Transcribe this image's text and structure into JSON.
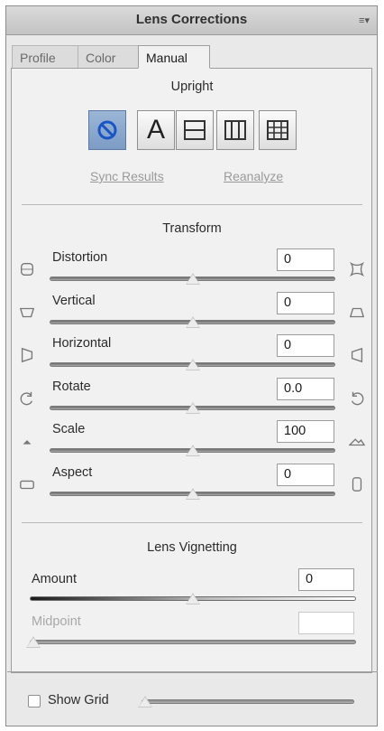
{
  "panel": {
    "title": "Lens Corrections",
    "menu_icon": "panel-menu-icon"
  },
  "tabs": [
    {
      "label": "Profile",
      "active": false
    },
    {
      "label": "Color",
      "active": false
    },
    {
      "label": "Manual",
      "active": true
    }
  ],
  "upright": {
    "title": "Upright",
    "buttons": [
      {
        "name": "off",
        "icon": "no-symbol-icon",
        "label": "",
        "selected": true
      },
      {
        "name": "auto",
        "icon": "",
        "label": "A",
        "selected": false
      },
      {
        "name": "level",
        "icon": "level-icon",
        "label": "",
        "selected": false
      },
      {
        "name": "vertical",
        "icon": "vertical-icon",
        "label": "",
        "selected": false
      },
      {
        "name": "full",
        "icon": "full-grid-icon",
        "label": "",
        "selected": false
      }
    ],
    "sync_label": "Sync Results",
    "reanalyze_label": "Reanalyze"
  },
  "transform": {
    "title": "Transform",
    "rows": [
      {
        "label": "Distortion",
        "value": "0",
        "fraction": 0.5,
        "left_icon": "barrel-distortion-icon",
        "right_icon": "pincushion-distortion-icon"
      },
      {
        "label": "Vertical",
        "value": "0",
        "fraction": 0.5,
        "left_icon": "vertical-perspective-down-icon",
        "right_icon": "vertical-perspective-up-icon"
      },
      {
        "label": "Horizontal",
        "value": "0",
        "fraction": 0.5,
        "left_icon": "horizontal-perspective-left-icon",
        "right_icon": "horizontal-perspective-right-icon"
      },
      {
        "label": "Rotate",
        "value": "0.0",
        "fraction": 0.5,
        "left_icon": "rotate-left-icon",
        "right_icon": "rotate-right-icon"
      },
      {
        "label": "Scale",
        "value": "100",
        "fraction": 0.5,
        "left_icon": "scale-down-icon",
        "right_icon": "scale-up-icon"
      },
      {
        "label": "Aspect",
        "value": "0",
        "fraction": 0.5,
        "left_icon": "aspect-wide-icon",
        "right_icon": "aspect-tall-icon"
      }
    ]
  },
  "vignetting": {
    "title": "Lens Vignetting",
    "amount_label": "Amount",
    "amount_value": "0",
    "amount_fraction": 0.5,
    "midpoint_label": "Midpoint",
    "midpoint_value": "",
    "midpoint_fraction": 0.0
  },
  "grid": {
    "label": "Show Grid",
    "checked": false,
    "fraction": 0.0
  }
}
